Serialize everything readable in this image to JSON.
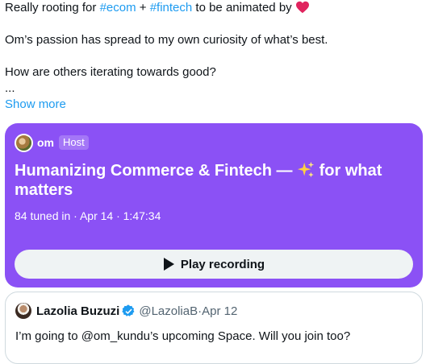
{
  "tweet": {
    "line1_prefix": "Really rooting for ",
    "hashtag1": "#ecom",
    "plus": " + ",
    "hashtag2": "#fintech",
    "line1_suffix": " to be animated by ",
    "line2": "Om’s passion has spread to my own curiosity of what’s best.",
    "line3": "How are others iterating towards good?",
    "ellipsis": "...",
    "show_more": "Show more"
  },
  "space": {
    "background": "#8b51f5",
    "host_name": "om",
    "host_badge": "Host",
    "title_prefix": "Humanizing Commerce & Fintech — ",
    "title_suffix": " for what matters",
    "meta": "84 tuned in · Apr 14 · 1:47:34",
    "play_label": "Play recording"
  },
  "quote": {
    "name": "Lazolia Buzuzi",
    "handle": "@LazoliaB",
    "separator": " · ",
    "date": "Apr 12",
    "text": "I’m going to @om_kundu’s upcoming Space. Will you join too?"
  },
  "icons": {
    "heart": "heart-icon",
    "sparkles": "sparkles-icon",
    "play": "play-icon",
    "verified": "verified-badge-icon"
  },
  "colors": {
    "link": "#1d9bf0",
    "space_bg": "#8b51f5",
    "button_bg": "#eff3f4",
    "text": "#0f1419",
    "muted": "#536471"
  }
}
